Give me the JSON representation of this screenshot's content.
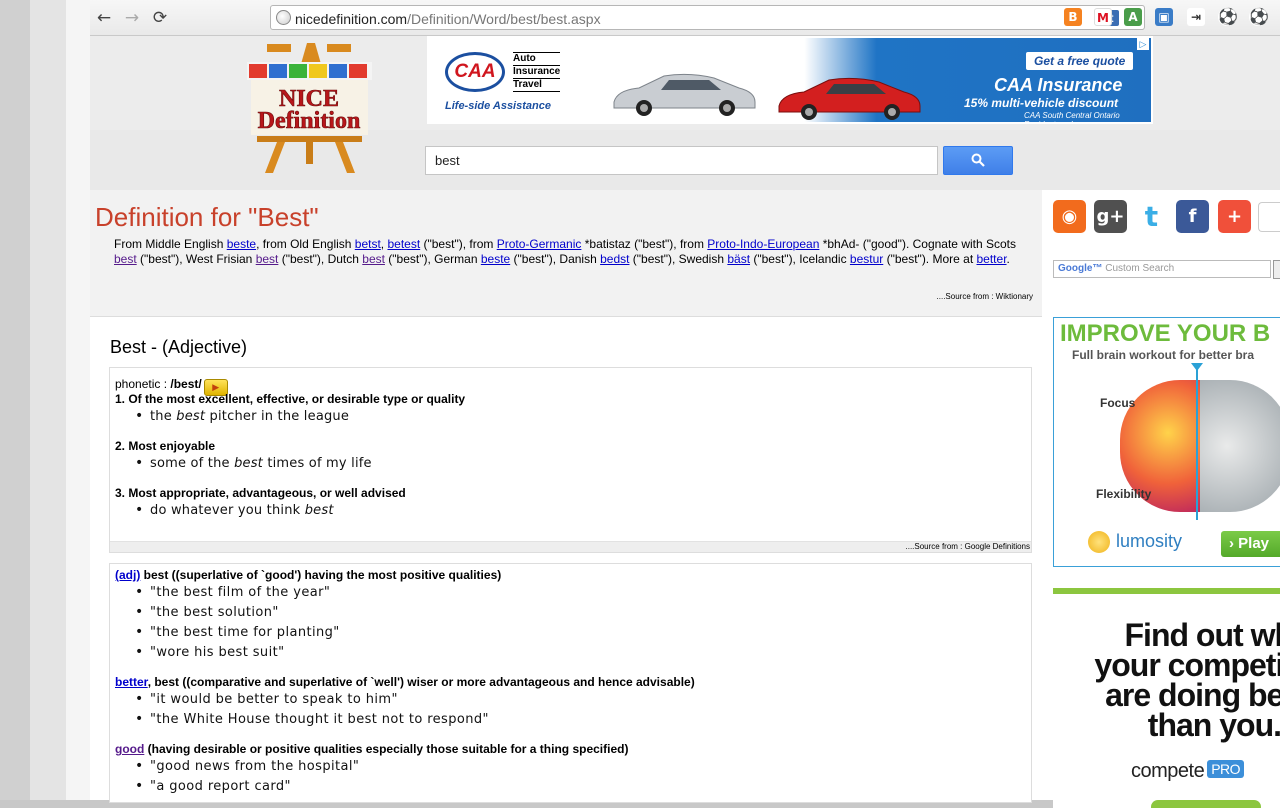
{
  "browser": {
    "url_host": "nicedefinition.com",
    "url_path": "/Definition/Word/best/best.aspx",
    "back_icon": "arrow-left-icon",
    "forward_icon": "arrow-right-icon",
    "reload_icon": "reload-icon",
    "tumblr_label": "t"
  },
  "ad_banner": {
    "brand": "CAA",
    "services": [
      "Auto",
      "Insurance",
      "Travel"
    ],
    "tagline": "Life-side Assistance",
    "cta": "Get a free quote",
    "title": "CAA Insurance",
    "discount": "15% multi-vehicle discount",
    "fine_print": "CAA South Central Ontario Residents only"
  },
  "search": {
    "value": "best"
  },
  "definition": {
    "title": "Definition for \"Best\"",
    "etymology": {
      "p1": "From Middle English ",
      "l1": "beste",
      "p2": ", from Old English ",
      "l2": "betst",
      "p3": ", ",
      "l3": "betest",
      "p4": " (\"best\"), from ",
      "l4": "Proto-Germanic",
      "p5": " *batistaz (\"best\"), from ",
      "l5": "Proto-Indo-European",
      "p6": " *bhAd- (\"good\"). Cognate with Scots ",
      "l6": "best",
      "p7": " (\"best\"), West Frisian ",
      "l7": "best",
      "p8": " (\"best\"), Dutch ",
      "l8": "best",
      "p9": " (\"best\"), German ",
      "l9": "beste",
      "p10": " (\"best\"), Danish ",
      "l10": "bedst",
      "p11": " (\"best\"), Swedish ",
      "l11": "bäst",
      "p12": " (\"best\"), Icelandic ",
      "l12": "bestur",
      "p13": " (\"best\"). More at ",
      "l13": "better",
      "p14": "."
    },
    "wiktionary_source": "....Source from : Wiktionary"
  },
  "pos_title": "Best - (Adjective)",
  "google_defs": {
    "phonetic_label": "phonetic : ",
    "phonetic_value": "/best/",
    "play_icon": "play-sound-icon",
    "senses": [
      {
        "label": "1. Of the most excellent, effective, or desirable type or quality",
        "ex_pre": "the ",
        "ex_em": "best",
        "ex_post": " pitcher in the league"
      },
      {
        "label": "2. Most enjoyable",
        "ex_pre": "some of the ",
        "ex_em": "best",
        "ex_post": " times of my life"
      },
      {
        "label": "3. Most appropriate, advantageous, or well advised",
        "ex_pre": "do whatever you think ",
        "ex_em": "best",
        "ex_post": ""
      }
    ],
    "source": "....Source from : Google Definitions"
  },
  "wordnet": {
    "entry1": {
      "link": "(adj)",
      "text": " best ((superlative of `good') having the most positive qualities)",
      "examples": [
        "\"the best film of the year\"",
        "\"the best solution\"",
        "\"the best time for planting\"",
        "\"wore his best suit\""
      ]
    },
    "entry2": {
      "link": "better",
      "text": ", best ((comparative and superlative of `well') wiser or more advantageous and hence advisable)",
      "examples": [
        "\"it would be better to speak to him\"",
        "\"the White House thought it best not to respond\""
      ]
    },
    "entry3": {
      "link": "good",
      "text": " (having desirable or positive qualities especially those suitable for a thing specified)",
      "examples": [
        "\"good news from the hospital\"",
        "\"a good report card\""
      ]
    }
  },
  "sidebar": {
    "social": [
      {
        "name": "rss-icon",
        "glyph": "◉",
        "color": "#f26b1d"
      },
      {
        "name": "google-plus-icon",
        "glyph": "g+",
        "color": "#505050"
      },
      {
        "name": "twitter-icon",
        "glyph": "t",
        "color": "#3aaee6"
      },
      {
        "name": "facebook-icon",
        "glyph": "f",
        "color": "#3b5998"
      },
      {
        "name": "addthis-plus-icon",
        "glyph": "+",
        "color": "#f0503a"
      }
    ],
    "cse_google": "Google™",
    "cse_label": " Custom Search",
    "lumosity_ad": {
      "headline": "IMPROVE YOUR B",
      "subline": "Full brain workout for better bra",
      "focus": "Focus",
      "flexibility": "Flexibility",
      "brand": "lumosity",
      "cta": "Play"
    },
    "compete_ad": {
      "line1": "Find out wh",
      "line2": "your competit",
      "line3": "are doing bet",
      "line4": "than you.",
      "brand": "compete",
      "pro": "PRO"
    }
  }
}
